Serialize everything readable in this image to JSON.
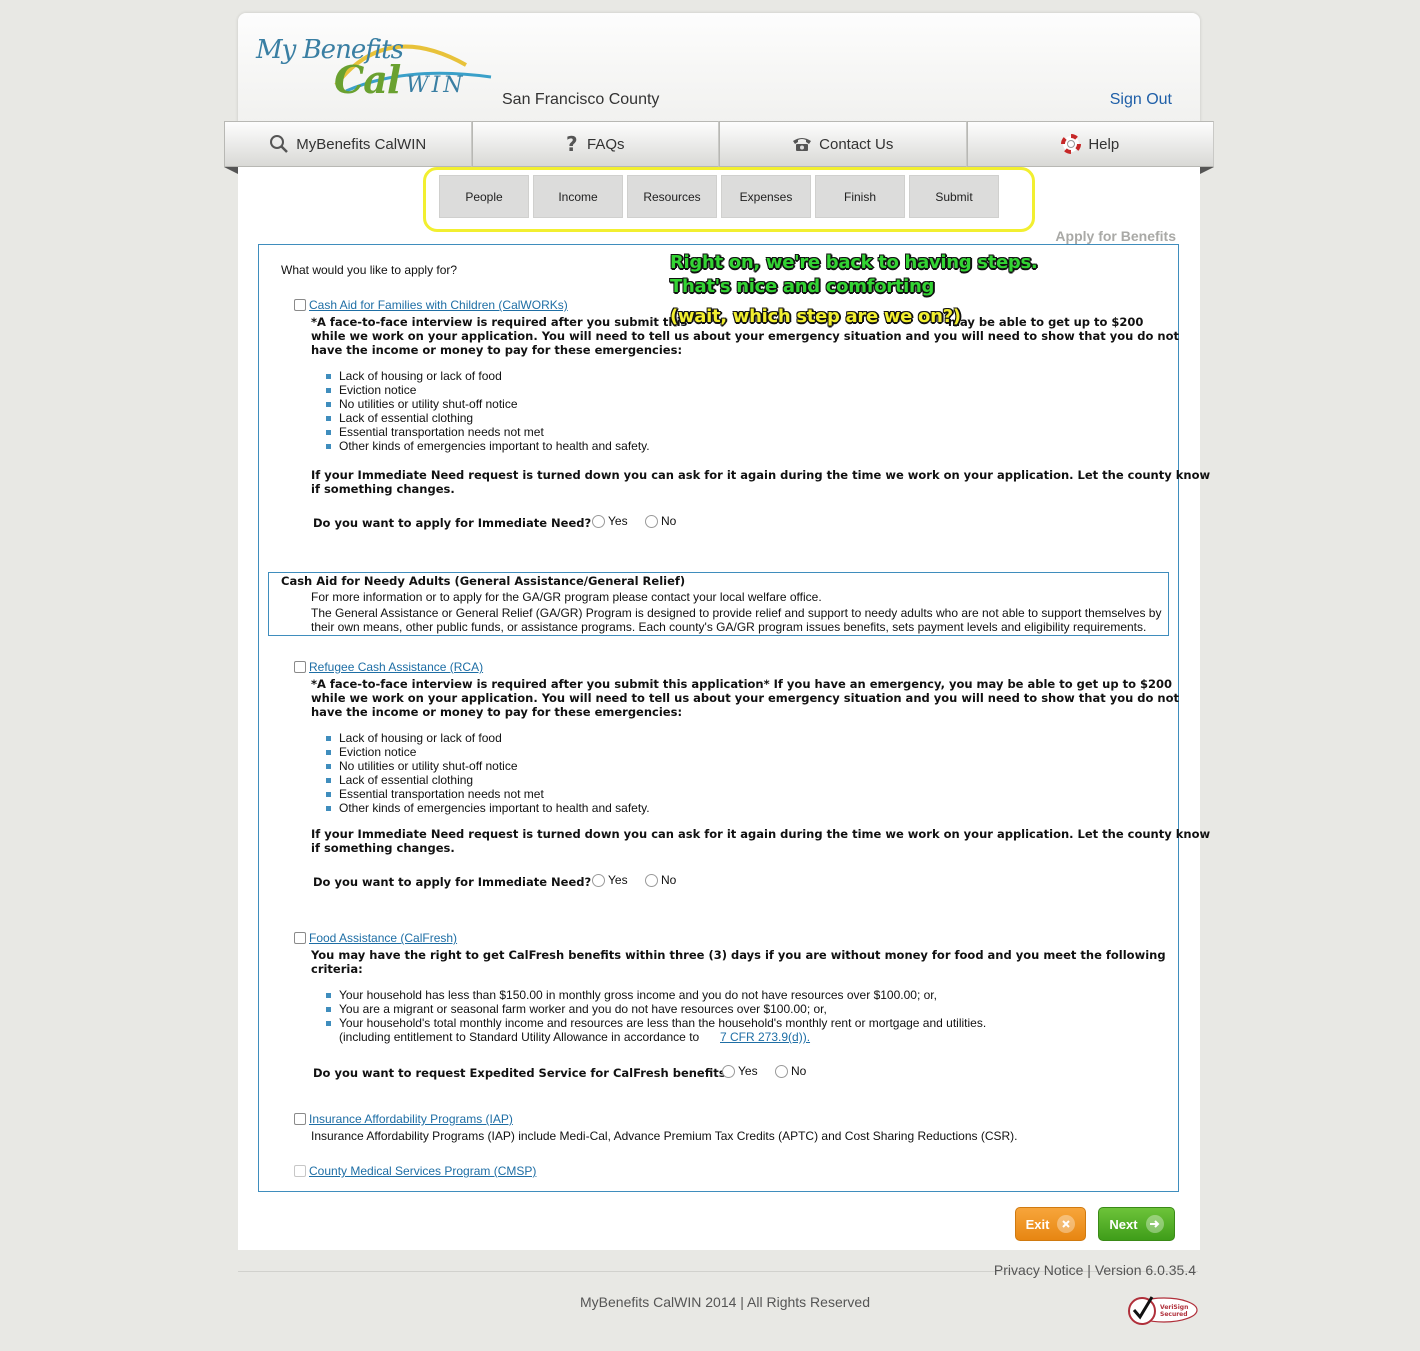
{
  "header": {
    "logo_my": "My Benefits",
    "logo_cal": "Cal",
    "logo_win": "WIN",
    "county": "San Francisco County",
    "signout": "Sign Out"
  },
  "nav": [
    {
      "label": "MyBenefits CalWIN",
      "icon": "magnifier-icon"
    },
    {
      "label": "FAQs",
      "icon": "question-icon"
    },
    {
      "label": "Contact Us",
      "icon": "phone-icon"
    },
    {
      "label": "Help",
      "icon": "lifebuoy-icon"
    }
  ],
  "steps": [
    "People",
    "Income",
    "Resources",
    "Expenses",
    "Finish",
    "Submit"
  ],
  "page_title": "Apply for Benefits",
  "form": {
    "question": "What would you like to apply for?",
    "annotation": {
      "line1": "Right on, we're back to having steps.",
      "line2": "That's nice and comforting",
      "line3": "(wait, which step are we on?)"
    },
    "calworks": {
      "label": "Cash Aid for Families with Children (CalWORKs)",
      "intro_1": "*A face-to-face interview is required after you submit this",
      "intro_1b": "may be able to get up to $200",
      "intro_2": "while we work on your application. You will need to tell us about your emergency situation and you will need to show that you do not",
      "intro_3": "have the income or money to pay for these emergencies:",
      "bullets": [
        "Lack of housing or lack of food",
        "Eviction notice",
        "No utilities or utility shut-off notice",
        "Lack of essential clothing",
        "Essential transportation needs not met",
        "Other kinds of emergencies important to health and safety."
      ],
      "note_1": "If your Immediate Need request is turned down you can ask for it again during the time we work on your application. Let the county know",
      "note_2": "if something changes.",
      "question": "Do you want to apply for Immediate Need?",
      "yes": "Yes",
      "no": "No"
    },
    "ga": {
      "title": "Cash Aid for Needy Adults (General Assistance/General Relief)",
      "line1": "For more information or to apply for the GA/GR program please contact your local welfare office.",
      "line2": "The General Assistance or General Relief (GA/GR) Program is designed to provide relief and support to needy adults who are not able to support themselves by",
      "line3": "their own means, other public funds, or assistance programs. Each county's GA/GR program issues benefits, sets payment levels and eligibility requirements."
    },
    "rca": {
      "label": "Refugee Cash Assistance (RCA)",
      "intro_1": "*A face-to-face interview is required after you submit this application* If you have an emergency, you may be able to get up to $200",
      "intro_2": "while we work on your application. You will need to tell us about your emergency situation and you will need to show that you do not",
      "intro_3": "have the income or money to pay for these emergencies:",
      "bullets": [
        "Lack of housing or lack of food",
        "Eviction notice",
        "No utilities or utility shut-off notice",
        "Lack of essential clothing",
        "Essential transportation needs not met",
        "Other kinds of emergencies important to health and safety."
      ],
      "note_1": "If your Immediate Need request is turned down you can ask for it again during the time we work on your application. Let the county know",
      "note_2": "if something changes.",
      "question": "Do you want to apply for Immediate Need?",
      "yes": "Yes",
      "no": "No"
    },
    "calfresh": {
      "label": "Food Assistance (CalFresh)",
      "intro_1": "You may have the right to get CalFresh benefits within three (3) days if you are without money for food and you meet the following",
      "intro_2": "criteria:",
      "bullets": [
        "Your household has less than $150.00 in monthly gross income and you do not have resources over $100.00; or,",
        "You are a migrant or seasonal farm worker and you do not have resources over $100.00; or,",
        "Your household's total monthly income and resources are less than the household's monthly rent or mortgage and utilities."
      ],
      "sua_text": "(including entitlement to Standard Utility Allowance in accordance to",
      "sua_link": "7 CFR 273.9(d)).",
      "question": "Do you want to request Expedited Service for CalFresh benefits?",
      "yes": "Yes",
      "no": "No"
    },
    "iap": {
      "label": "Insurance Affordability Programs (IAP)",
      "desc": "Insurance Affordability Programs (IAP) include Medi-Cal, Advance Premium Tax Credits (APTC) and Cost Sharing Reductions (CSR)."
    },
    "cmsp": {
      "label": "County Medical Services Program (CMSP)"
    }
  },
  "buttons": {
    "exit": "Exit",
    "next": "Next"
  },
  "footer": {
    "privacy": "Privacy Notice",
    "separator": "|",
    "version": "Version  6.0.35.4",
    "copyright": "MyBenefits CalWIN 2014 | All Rights Reserved",
    "seal_line1": "VeriSign",
    "seal_line2": "Secured"
  },
  "colors": {
    "accent_blue": "#3f8dbd",
    "link_blue": "#1e6ea5",
    "annotation_green": "#33d433",
    "annotation_yellow": "#f2ef30",
    "exit_orange": "#e78612",
    "next_green": "#3f9d1a"
  }
}
